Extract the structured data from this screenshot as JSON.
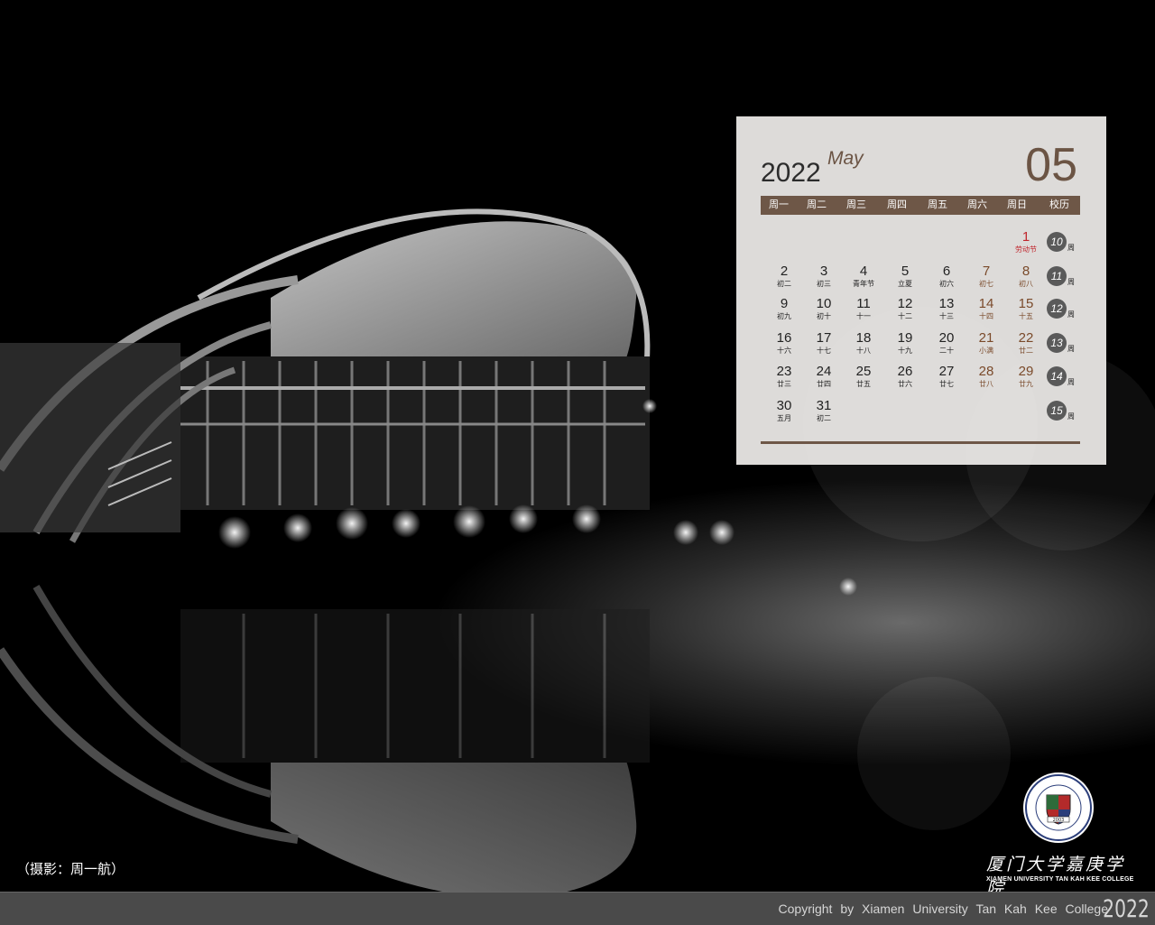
{
  "photo": {
    "description_icon": "building-night-reflection"
  },
  "calendar": {
    "year": "2022",
    "month_en": "May",
    "month_num": "05",
    "headers": [
      "周一",
      "周二",
      "周三",
      "周四",
      "周五",
      "周六",
      "周日",
      "校历"
    ],
    "days": [
      {
        "n": "1",
        "s": "劳动节",
        "col": 6,
        "row": 0,
        "t": "holiday"
      },
      {
        "n": "2",
        "s": "初二",
        "col": 0,
        "row": 1,
        "t": ""
      },
      {
        "n": "3",
        "s": "初三",
        "col": 1,
        "row": 1,
        "t": ""
      },
      {
        "n": "4",
        "s": "青年节",
        "col": 2,
        "row": 1,
        "t": ""
      },
      {
        "n": "5",
        "s": "立夏",
        "col": 3,
        "row": 1,
        "t": ""
      },
      {
        "n": "6",
        "s": "初六",
        "col": 4,
        "row": 1,
        "t": ""
      },
      {
        "n": "7",
        "s": "初七",
        "col": 5,
        "row": 1,
        "t": "weekend"
      },
      {
        "n": "8",
        "s": "初八",
        "col": 6,
        "row": 1,
        "t": "weekend"
      },
      {
        "n": "9",
        "s": "初九",
        "col": 0,
        "row": 2,
        "t": ""
      },
      {
        "n": "10",
        "s": "初十",
        "col": 1,
        "row": 2,
        "t": ""
      },
      {
        "n": "11",
        "s": "十一",
        "col": 2,
        "row": 2,
        "t": ""
      },
      {
        "n": "12",
        "s": "十二",
        "col": 3,
        "row": 2,
        "t": ""
      },
      {
        "n": "13",
        "s": "十三",
        "col": 4,
        "row": 2,
        "t": ""
      },
      {
        "n": "14",
        "s": "十四",
        "col": 5,
        "row": 2,
        "t": "weekend"
      },
      {
        "n": "15",
        "s": "十五",
        "col": 6,
        "row": 2,
        "t": "weekend"
      },
      {
        "n": "16",
        "s": "十六",
        "col": 0,
        "row": 3,
        "t": ""
      },
      {
        "n": "17",
        "s": "十七",
        "col": 1,
        "row": 3,
        "t": ""
      },
      {
        "n": "18",
        "s": "十八",
        "col": 2,
        "row": 3,
        "t": ""
      },
      {
        "n": "19",
        "s": "十九",
        "col": 3,
        "row": 3,
        "t": ""
      },
      {
        "n": "20",
        "s": "二十",
        "col": 4,
        "row": 3,
        "t": ""
      },
      {
        "n": "21",
        "s": "小满",
        "col": 5,
        "row": 3,
        "t": "weekend"
      },
      {
        "n": "22",
        "s": "廿二",
        "col": 6,
        "row": 3,
        "t": "weekend"
      },
      {
        "n": "23",
        "s": "廿三",
        "col": 0,
        "row": 4,
        "t": ""
      },
      {
        "n": "24",
        "s": "廿四",
        "col": 1,
        "row": 4,
        "t": ""
      },
      {
        "n": "25",
        "s": "廿五",
        "col": 2,
        "row": 4,
        "t": ""
      },
      {
        "n": "26",
        "s": "廿六",
        "col": 3,
        "row": 4,
        "t": ""
      },
      {
        "n": "27",
        "s": "廿七",
        "col": 4,
        "row": 4,
        "t": ""
      },
      {
        "n": "28",
        "s": "廿八",
        "col": 5,
        "row": 4,
        "t": "weekend"
      },
      {
        "n": "29",
        "s": "廿九",
        "col": 6,
        "row": 4,
        "t": "weekend"
      },
      {
        "n": "30",
        "s": "五月",
        "col": 0,
        "row": 5,
        "t": ""
      },
      {
        "n": "31",
        "s": "初二",
        "col": 1,
        "row": 5,
        "t": ""
      }
    ],
    "weeks": [
      "10",
      "11",
      "12",
      "13",
      "14",
      "15"
    ],
    "week_unit": "周",
    "colors": {
      "accent": "#6e5747",
      "holiday": "#c0262d",
      "weekend": "#7a4a2a"
    }
  },
  "credit": "（摄影：周一航）",
  "logo": {
    "name_cn": "厦门大学嘉庚学院",
    "name_en": "XIAMEN UNIVERSITY TAN KAH KEE COLLEGE",
    "seal_year": "2003"
  },
  "footer": {
    "copyright": "Copyright by Xiamen University Tan Kah Kee College",
    "year": "2022"
  }
}
